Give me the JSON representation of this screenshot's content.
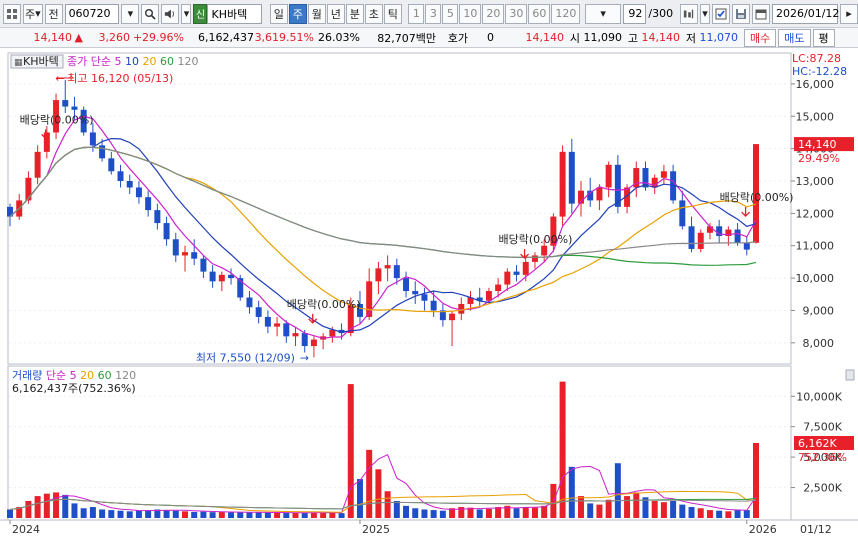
{
  "toolbar": {
    "menu_label": "주",
    "jeon_label": "전",
    "code": "060720",
    "stock_name": "KH바텍",
    "badge_label": "신",
    "periods": [
      "일",
      "주",
      "월",
      "년",
      "분",
      "초",
      "틱"
    ],
    "active_period": "주",
    "numbers": [
      "1",
      "3",
      "5",
      "10",
      "20",
      "30",
      "60",
      "120"
    ],
    "count": "92",
    "count_total": "/300",
    "date": "2026/01/12"
  },
  "quote": {
    "price": "14,140",
    "change": "3,260",
    "change_pct": "+29.96%",
    "volume": "6,162,437",
    "volume_pct": "3,619.51%",
    "turnover": "26.03%",
    "amount": "82,707백만",
    "hoga_label": "호가",
    "hoga_value": "0",
    "current_value": "14,140",
    "open_label": "시",
    "open_value": "11,090",
    "high_label": "고",
    "high_value": "14,140",
    "low_label": "저",
    "low_value": "11,070",
    "buy_label": "매수",
    "sell_label": "매도",
    "eval_label": "평"
  },
  "price_panel": {
    "stock_label": "KH바텍",
    "legend_prefix": "종가 단순",
    "ma": [
      {
        "period": "5",
        "color": "#cc22cc"
      },
      {
        "period": "10",
        "color": "#1f3fb8"
      },
      {
        "period": "20",
        "color": "#e8a000"
      },
      {
        "period": "60",
        "color": "#2c9c3c"
      },
      {
        "period": "120",
        "color": "#888888"
      }
    ],
    "lc": "LC:87.28",
    "hc": "HC:-12.28",
    "high_annot": "최고 16,120 (05/13)",
    "low_annot": "최저 7,550 (12/09)",
    "dividend_labels": [
      "배당락(0.00%)",
      "배당락(0.00%)",
      "배당락(0.00%)",
      "배당락(0.00%)"
    ],
    "price_tag": "14,140",
    "pct_tag": "29.49%",
    "y_ticks": [
      "16,000",
      "15,000",
      "14,000",
      "13,000",
      "12,000",
      "11,000",
      "10,000",
      "9,000",
      "8,000"
    ]
  },
  "volume_panel": {
    "title": "거래량",
    "legend_prefix": "단순",
    "ma": [
      {
        "period": "5",
        "color": "#cc22cc"
      },
      {
        "period": "20",
        "color": "#e8a000"
      },
      {
        "period": "60",
        "color": "#2c9c3c"
      },
      {
        "period": "120",
        "color": "#888888"
      }
    ],
    "info": "6,162,437주(752.36%)",
    "vol_tag": "6,162K",
    "pct_tag": "752.36%",
    "y_ticks": [
      "10,000K",
      "7,500K",
      "5,000K",
      "2,500K"
    ]
  },
  "x_axis": {
    "labels": [
      "2024",
      "2025",
      "2026"
    ],
    "right_label": "01/12"
  },
  "chart_data": {
    "type": "candlestick",
    "period": "weekly",
    "price_axis": [
      7500,
      16800
    ],
    "volume_axis": [
      0,
      11500
    ],
    "volume_unit": "K",
    "x_labels": [
      "2024",
      "2025",
      "2026"
    ],
    "candles": [
      [
        12200,
        12300,
        11600,
        11900,
        700
      ],
      [
        11900,
        12600,
        11800,
        12400,
        900
      ],
      [
        12400,
        13300,
        12300,
        13100,
        1400
      ],
      [
        13100,
        14100,
        12900,
        13900,
        1800
      ],
      [
        13900,
        14700,
        13700,
        14500,
        2000
      ],
      [
        14500,
        15700,
        14300,
        15500,
        2100
      ],
      [
        15500,
        16120,
        15100,
        15300,
        1900
      ],
      [
        15300,
        15600,
        14900,
        15200,
        1200
      ],
      [
        15200,
        15300,
        14400,
        14500,
        800
      ],
      [
        14500,
        14800,
        13900,
        14100,
        900
      ],
      [
        14100,
        14300,
        13600,
        13700,
        700
      ],
      [
        13700,
        13900,
        13200,
        13300,
        650
      ],
      [
        13300,
        13500,
        12800,
        13000,
        600
      ],
      [
        13000,
        13200,
        12600,
        12800,
        550
      ],
      [
        12800,
        13000,
        12300,
        12500,
        600
      ],
      [
        12500,
        12700,
        11900,
        12100,
        650
      ],
      [
        12100,
        12300,
        11500,
        11700,
        700
      ],
      [
        11700,
        11900,
        11000,
        11200,
        650
      ],
      [
        11200,
        11400,
        10500,
        10700,
        600
      ],
      [
        10700,
        11000,
        10200,
        10800,
        550
      ],
      [
        10800,
        11200,
        10400,
        10600,
        500
      ],
      [
        10600,
        10700,
        10000,
        10200,
        520
      ],
      [
        10200,
        10400,
        9700,
        9900,
        480
      ],
      [
        9900,
        10200,
        9600,
        10100,
        500
      ],
      [
        10100,
        10300,
        9800,
        10000,
        460
      ],
      [
        10000,
        10100,
        9300,
        9400,
        480
      ],
      [
        9400,
        9600,
        8900,
        9100,
        460
      ],
      [
        9100,
        9300,
        8600,
        8800,
        450
      ],
      [
        8800,
        9000,
        8300,
        8500,
        440
      ],
      [
        8500,
        8800,
        8200,
        8600,
        430
      ],
      [
        8600,
        8700,
        8000,
        8200,
        420
      ],
      [
        8200,
        8500,
        7900,
        8300,
        410
      ],
      [
        8300,
        8400,
        7700,
        7900,
        420
      ],
      [
        7900,
        8200,
        7550,
        8100,
        450
      ],
      [
        8100,
        8300,
        7800,
        8200,
        420
      ],
      [
        8200,
        8500,
        8000,
        8400,
        430
      ],
      [
        8400,
        8600,
        8100,
        8300,
        400
      ],
      [
        8300,
        9400,
        8200,
        9200,
        11000
      ],
      [
        9200,
        9600,
        8600,
        8800,
        3200
      ],
      [
        8800,
        10300,
        8700,
        9900,
        5600
      ],
      [
        9900,
        10500,
        9500,
        10300,
        4000
      ],
      [
        10300,
        10700,
        9900,
        10400,
        2200
      ],
      [
        10400,
        10600,
        9800,
        10000,
        1400
      ],
      [
        10000,
        10200,
        9400,
        9600,
        1000
      ],
      [
        9600,
        9900,
        9200,
        9500,
        800
      ],
      [
        9500,
        9700,
        9000,
        9300,
        700
      ],
      [
        9300,
        9600,
        8800,
        9000,
        650
      ],
      [
        9000,
        9200,
        8500,
        8700,
        600
      ],
      [
        8700,
        9000,
        7900,
        8900,
        800
      ],
      [
        8900,
        9400,
        8700,
        9200,
        900
      ],
      [
        9200,
        9600,
        9000,
        9400,
        850
      ],
      [
        9400,
        9700,
        9100,
        9300,
        700
      ],
      [
        9300,
        9700,
        9200,
        9600,
        750
      ],
      [
        9600,
        10000,
        9400,
        9800,
        900
      ],
      [
        9800,
        10300,
        9600,
        10200,
        1000
      ],
      [
        10200,
        10400,
        9900,
        10100,
        800
      ],
      [
        10100,
        10700,
        9900,
        10500,
        900
      ],
      [
        10500,
        10800,
        10300,
        10700,
        850
      ],
      [
        10700,
        11200,
        10500,
        11000,
        1000
      ],
      [
        11000,
        12000,
        10800,
        11900,
        2800
      ],
      [
        11900,
        14100,
        11600,
        13900,
        11200
      ],
      [
        13900,
        14300,
        12000,
        12300,
        4200
      ],
      [
        12300,
        13000,
        11900,
        12700,
        1800
      ],
      [
        12700,
        13100,
        12200,
        12400,
        1200
      ],
      [
        12400,
        12900,
        12100,
        12800,
        1100
      ],
      [
        12800,
        13600,
        12500,
        13500,
        1500
      ],
      [
        13500,
        13800,
        12000,
        12200,
        4500
      ],
      [
        12200,
        12900,
        12000,
        12800,
        1800
      ],
      [
        12800,
        13600,
        12500,
        13400,
        2100
      ],
      [
        13400,
        13600,
        12700,
        12800,
        1700
      ],
      [
        12800,
        13200,
        12600,
        13100,
        1400
      ],
      [
        13100,
        13500,
        12900,
        13300,
        1300
      ],
      [
        13300,
        13500,
        12300,
        12400,
        1400
      ],
      [
        12400,
        12700,
        11500,
        11600,
        1100
      ],
      [
        11600,
        11900,
        10800,
        10900,
        900
      ],
      [
        10900,
        11500,
        10800,
        11400,
        800
      ],
      [
        11400,
        11700,
        11200,
        11600,
        650
      ],
      [
        11600,
        11800,
        11100,
        11300,
        600
      ],
      [
        11300,
        11600,
        11000,
        11500,
        550
      ],
      [
        11500,
        11700,
        11000,
        11100,
        700
      ],
      [
        11100,
        11300,
        10700,
        10880,
        650
      ],
      [
        11090,
        14140,
        11070,
        14140,
        6162
      ]
    ]
  }
}
